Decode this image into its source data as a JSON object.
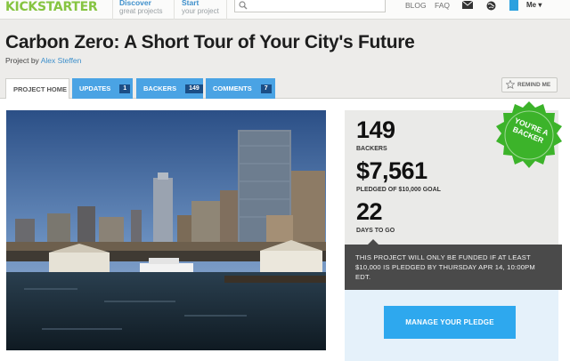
{
  "nav": {
    "logo_part1": "KICK",
    "logo_part2": "STARTER",
    "discover_label": "Discover",
    "discover_sub": "great projects",
    "start_label": "Start",
    "start_sub": "your project",
    "search_placeholder": "",
    "blog_label": "BLOG",
    "faq_label": "FAQ",
    "me_label": "Me ▾"
  },
  "project": {
    "title": "Carbon Zero: A Short Tour of Your City's Future",
    "by_prefix": "Project by",
    "creator": "Alex Steffen"
  },
  "tabs": [
    {
      "label": "Project Home"
    },
    {
      "label": "Updates",
      "count": "1"
    },
    {
      "label": "Backers",
      "count": "149"
    },
    {
      "label": "Comments",
      "count": "7"
    }
  ],
  "remind_label": "REMIND ME",
  "stats": {
    "backers_value": "149",
    "backers_label": "Backers",
    "pledged_value": "$7,561",
    "pledged_label": "Pledged of $10,000 goal",
    "days_value": "22",
    "days_label": "Days to go",
    "badge_text": "You're a Backer",
    "notice": "This project will only be funded if at least $10,000 is pledged by Thursday Apr 14, 10:00pm EDT.",
    "manage_label": "Manage Your Pledge"
  },
  "colors": {
    "brand_green": "#86c441",
    "link_blue": "#3d8fcb",
    "tab_blue": "#4aa3e4",
    "count_navy": "#1b4e86",
    "button_blue": "#2ea8ee",
    "badge_green": "#3cb32a"
  },
  "icons": [
    "search-icon",
    "mail-icon",
    "globe-icon",
    "star-icon"
  ]
}
